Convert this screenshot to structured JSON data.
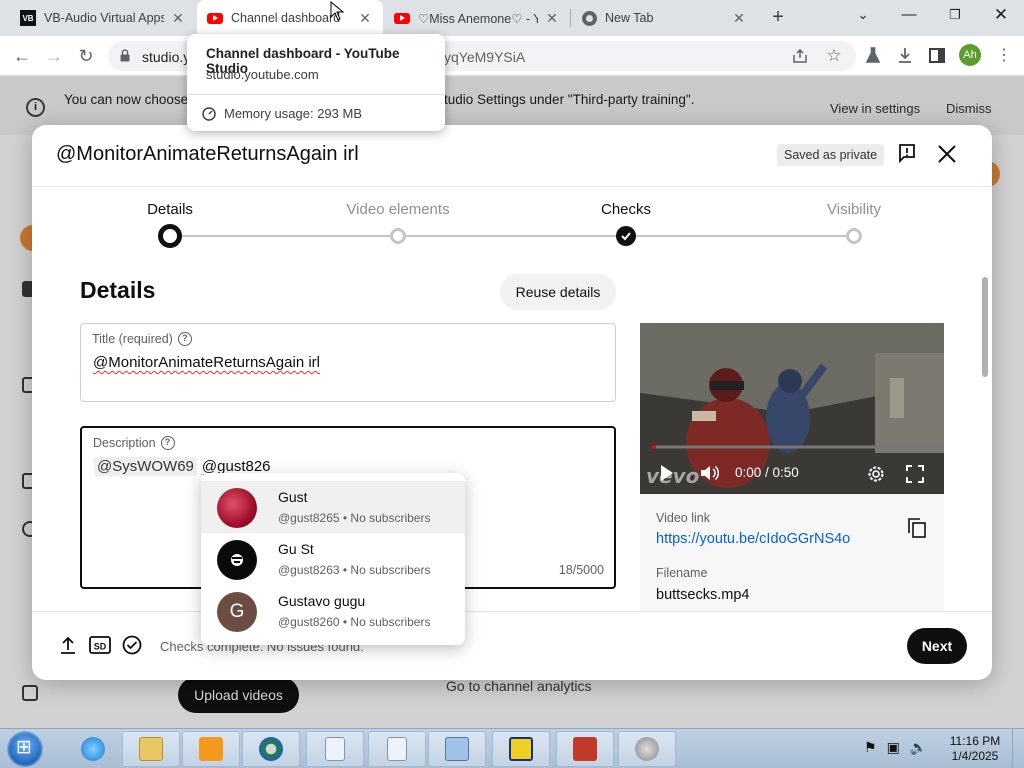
{
  "browser": {
    "tabs": [
      {
        "title": "VB-Audio Virtual Apps",
        "favicon": "vb-audio-icon",
        "active": false
      },
      {
        "title": "Channel dashboard",
        "favicon": "youtube-icon",
        "active": true
      },
      {
        "title": "♡Miss Anemone♡ - Yo",
        "favicon": "youtube-icon",
        "active": false
      },
      {
        "title": "New Tab",
        "favicon": "chrome-icon",
        "active": false
      }
    ],
    "url_host": "studio.y",
    "url_tail": "yqYeM9YSiA",
    "profile_initials": "Ah",
    "tooltip": {
      "title": "Channel dashboard - YouTube Studio",
      "host": "studio.youtube.com",
      "memory": "Memory usage: 293 MB"
    }
  },
  "banner": {
    "text": "You can now choose … use your content to train AI models in Studio Settings under \"Third-party training\".",
    "view_settings": "View in settings",
    "dismiss": "Dismiss"
  },
  "background": {
    "upload_videos": "Upload videos",
    "go_to_analytics": "Go to channel analytics"
  },
  "dialog": {
    "title": "@MonitorAnimateReturnsAgain irl",
    "saved_status": "Saved as private",
    "steps": [
      {
        "label": "Details",
        "state": "current"
      },
      {
        "label": "Video elements",
        "state": "pending"
      },
      {
        "label": "Checks",
        "state": "done"
      },
      {
        "label": "Visibility",
        "state": "pending"
      }
    ],
    "section_heading": "Details",
    "reuse_details": "Reuse details",
    "title_field": {
      "label": "Title (required)",
      "value": "@MonitorAnimateReturnsAgain irl"
    },
    "description_field": {
      "label": "Description",
      "mention_chip": "@SysWOW69",
      "typing": "@gust826",
      "counter": "18/5000"
    },
    "video": {
      "time": "0:00 / 0:50",
      "watermark": "vevo",
      "link_label": "Video link",
      "link": "https://youtu.be/cIdoGGrNS4o",
      "filename_label": "Filename",
      "filename": "buttsecks.mp4"
    },
    "footer": {
      "checks_message": "Checks complete. No issues found.",
      "next": "Next"
    }
  },
  "mentions": [
    {
      "name": "Gust",
      "handle": "@gust8265 • No subscribers",
      "avatar": "red-pattern"
    },
    {
      "name": "Gu St",
      "handle": "@gust8263 • No subscribers",
      "avatar": "black-logo"
    },
    {
      "name": "Gustavo gugu",
      "handle": "@gust8260 • No subscribers",
      "avatar": "letter",
      "initial": "G"
    }
  ],
  "taskbar": {
    "time": "11:16 PM",
    "date": "1/4/2025"
  },
  "colors": {
    "accent_link": "#065fd4",
    "youtube_red": "#ff0000",
    "primary_button": "#0f0f0f",
    "profile_green": "#5a9e2f"
  }
}
